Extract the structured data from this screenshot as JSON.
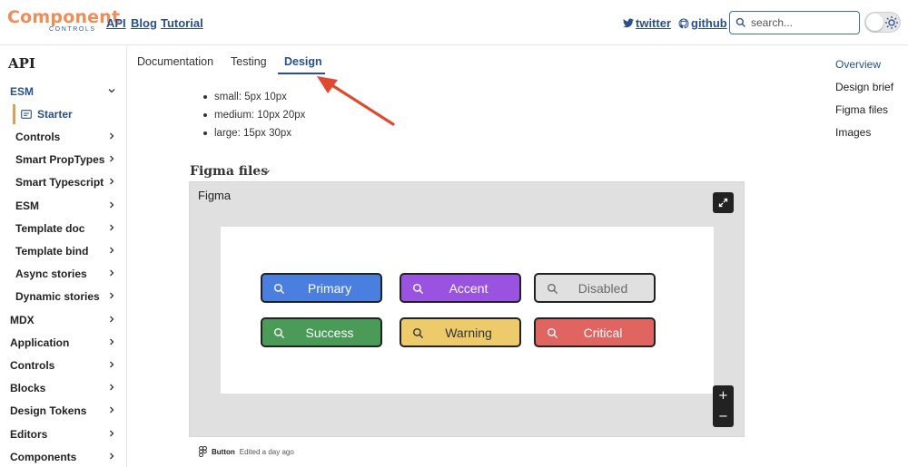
{
  "header": {
    "logo_main": "Component",
    "logo_sub": "CONTROLS",
    "nav": [
      "API",
      "Blog",
      "Tutorial"
    ],
    "twitter_label": "twitter",
    "github_label": "github",
    "search_placeholder": "search..."
  },
  "sidebar": {
    "title": "API",
    "esm_label": "ESM",
    "starter_label": "Starter",
    "items": [
      {
        "label": "Controls",
        "indent": true
      },
      {
        "label": "Smart PropTypes",
        "indent": true
      },
      {
        "label": "Smart Typescript",
        "indent": true
      },
      {
        "label": "ESM",
        "indent": true
      },
      {
        "label": "Template doc",
        "indent": true
      },
      {
        "label": "Template bind",
        "indent": true
      },
      {
        "label": "Async stories",
        "indent": true
      },
      {
        "label": "Dynamic stories",
        "indent": true
      },
      {
        "label": "MDX",
        "indent": false
      },
      {
        "label": "Application",
        "indent": false
      },
      {
        "label": "Controls",
        "indent": false
      },
      {
        "label": "Blocks",
        "indent": false
      },
      {
        "label": "Design Tokens",
        "indent": false
      },
      {
        "label": "Editors",
        "indent": false
      },
      {
        "label": "Components",
        "indent": false
      }
    ]
  },
  "tabs": [
    "Documentation",
    "Testing",
    "Design"
  ],
  "active_tab": "Design",
  "bullets": [
    "small: 5px 10px",
    "medium: 10px 20px",
    "large: 15px 30px"
  ],
  "figma_section": {
    "heading": "Figma files",
    "frame_label": "Figma",
    "buttons": [
      {
        "label": "Primary",
        "color": "#4a7fe0"
      },
      {
        "label": "Accent",
        "color": "#9a52e0"
      },
      {
        "label": "Disabled",
        "color": "#e0e0e0",
        "text_color": "#6a6a6a"
      },
      {
        "label": "Success",
        "color": "#4a9a58"
      },
      {
        "label": "Warning",
        "color": "#eecb6a",
        "text_color": "#333333"
      },
      {
        "label": "Critical",
        "color": "#e06560"
      }
    ],
    "zoom_in": "+",
    "zoom_out": "−",
    "footer_file": "Button",
    "footer_meta": "Edited a day ago"
  },
  "toc": [
    "Overview",
    "Design brief",
    "Figma files",
    "Images"
  ],
  "colors": {
    "accent": "#2a4f8c",
    "annotation_arrow": "#e0492f",
    "logo": "#f28c55"
  }
}
